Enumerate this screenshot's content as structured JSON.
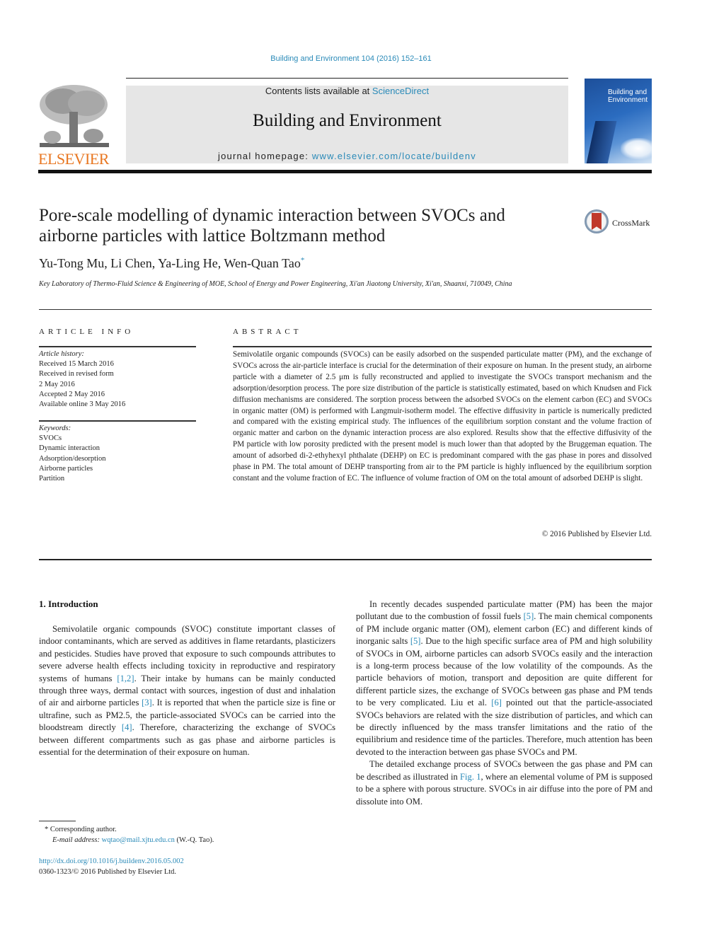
{
  "header": {
    "citation": "Building and Environment 104 (2016) 152–161",
    "contents_prefix": "Contents lists available at ",
    "contents_link": "ScienceDirect",
    "journal_title": "Building and Environment",
    "homepage_prefix": "journal homepage: ",
    "homepage_link": "www.elsevier.com/locate/buildenv",
    "publisher_logo_text": "ELSEVIER",
    "cover_title_line1": "Building and",
    "cover_title_line2": "Environment",
    "crossmark_label": "CrossMark"
  },
  "colors": {
    "link": "#2a8ab8",
    "elsevier_orange": "#e87722",
    "masthead_bg": "#e6e6e6"
  },
  "article": {
    "title": "Pore-scale modelling of dynamic interaction between SVOCs and airborne particles with lattice Boltzmann method",
    "authors": "Yu-Tong Mu, Li Chen, Ya-Ling He, Wen-Quan Tao",
    "author_mark": "*",
    "affiliation": "Key Laboratory of Thermo-Fluid Science & Engineering of MOE, School of Energy and Power Engineering, Xi'an Jiaotong University, Xi'an, Shaanxi, 710049, China"
  },
  "article_info": {
    "heading": "ARTICLE INFO",
    "history_label": "Article history:",
    "history": [
      "Received 15 March 2016",
      "Received in revised form",
      "2 May 2016",
      "Accepted 2 May 2016",
      "Available online 3 May 2016"
    ],
    "keywords_label": "Keywords:",
    "keywords": [
      "SVOCs",
      "Dynamic interaction",
      "Adsorption/desorption",
      "Airborne particles",
      "Partition"
    ]
  },
  "abstract": {
    "heading": "ABSTRACT",
    "text": "Semivolatile organic compounds (SVOCs) can be easily adsorbed on the suspended particulate matter (PM), and the exchange of SVOCs across the air-particle interface is crucial for the determination of their exposure on human. In the present study, an airborne particle with a diameter of 2.5 μm is fully reconstructed and applied to investigate the SVOCs transport mechanism and the adsorption/desorption process. The pore size distribution of the particle is statistically estimated, based on which Knudsen and Fick diffusion mechanisms are considered. The sorption process between the adsorbed SVOCs on the element carbon (EC) and SVOCs in organic matter (OM) is performed with Langmuir-isotherm model. The effective diffusivity in particle is numerically predicted and compared with the existing empirical study. The influences of the equilibrium sorption constant and the volume fraction of organic matter and carbon on the dynamic interaction process are also explored. Results show that the effective diffusivity of the PM particle with low porosity predicted with the present model is much lower than that adopted by the Bruggeman equation. The amount of adsorbed di-2-ethyhexyl phthalate (DEHP) on EC is predominant compared with the gas phase in pores and dissolved phase in PM. The total amount of DEHP transporting from air to the PM particle is highly influenced by the equilibrium sorption constant and the volume fraction of EC. The influence of volume fraction of OM on the total amount of adsorbed DEHP is slight.",
    "copyright": "© 2016 Published by Elsevier Ltd."
  },
  "body": {
    "section_heading": "1.  Introduction",
    "left_p1": [
      "Semivolatile organic compounds (SVOC) constitute important classes of indoor contaminants, which are served as additives in flame retardants, plasticizers and pesticides. Studies have proved that exposure to such compounds attributes to severe adverse health effects including toxicity in reproductive and respiratory systems of humans ",
      "[1,2]",
      ". Their intake by humans can be mainly conducted through three ways, dermal contact with sources, ingestion of dust and inhalation of air and airborne particles ",
      "[3]",
      ". It is reported that when the particle size is fine or ultrafine, such as PM2.5, the particle-associated SVOCs can be carried into the bloodstream directly ",
      "[4]",
      ". Therefore, characterizing the exchange of SVOCs between different compartments such as gas phase and airborne particles is essential for the determination of their exposure on human."
    ],
    "right_p1": [
      "In recently decades suspended particulate matter (PM) has been the major pollutant due to the combustion of fossil fuels ",
      "[5]",
      ". The main chemical components of PM include organic matter (OM), element carbon (EC) and different kinds of inorganic salts ",
      "[5]",
      ". Due to the high specific surface area of PM and high solubility of SVOCs in OM, airborne particles can adsorb SVOCs easily and the interaction is a long-term process because of the low volatility of the compounds. As the particle behaviors of motion, transport and deposition are quite different for different particle sizes, the exchange of SVOCs between gas phase and PM tends to be very complicated. Liu et al. ",
      "[6]",
      " pointed out that the particle-associated SVOCs behaviors are related with the size distribution of particles, and which can be directly influenced by the mass transfer limitations and the ratio of the equilibrium and residence time of the particles. Therefore, much attention has been devoted to the interaction between gas phase SVOCs and PM."
    ],
    "right_p2": [
      "The detailed exchange process of SVOCs between the gas phase and PM can be described as illustrated in ",
      "Fig. 1",
      ", where an elemental volume of PM is supposed to be a sphere with porous structure. SVOCs in air diffuse into the pore of PM and dissolute into OM."
    ]
  },
  "footnotes": {
    "corresponding": "* Corresponding author.",
    "email_label": "E-mail address: ",
    "email": "wqtao@mail.xjtu.edu.cn",
    "email_suffix": " (W.-Q. Tao).",
    "doi": "http://dx.doi.org/10.1016/j.buildenv.2016.05.002",
    "issn": "0360-1323/© 2016 Published by Elsevier Ltd."
  }
}
